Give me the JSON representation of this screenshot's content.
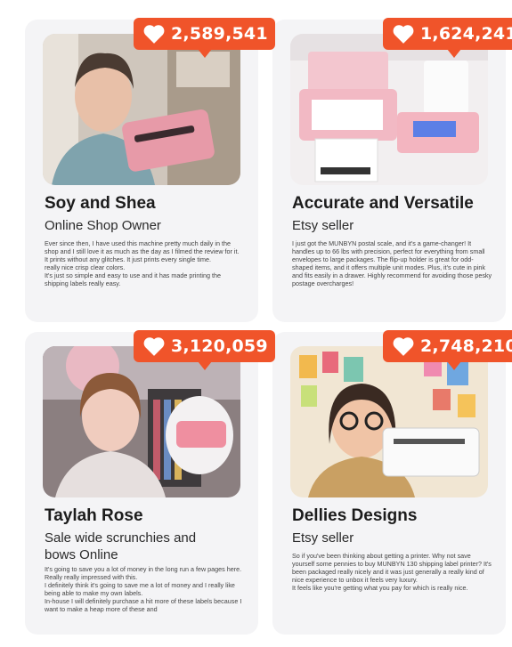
{
  "testimonials": [
    {
      "likes": "2,589,541",
      "name": "Soy and Shea",
      "role": "Online Shop Owner",
      "review": "Ever since then, I have used this machine pretty much daily in the shop and I still love it as much as the day as I filmed the review for it.\nIt prints without any glitches. It just prints every single time.\nreally nice crisp clear colors.\nIt's just so simple and easy to use and it has made printing the shipping labels really easy."
    },
    {
      "likes": "1,624,241",
      "name": "Accurate and Versatile",
      "role": "Etsy seller",
      "review": "I just got the MUNBYN postal scale, and it's a game-changer! It handles up to 66 lbs with precision, perfect for everything from small envelopes to large packages. The flip-up holder is great for odd-shaped items, and it offers multiple unit modes. Plus, it's cute in pink and fits easily in a drawer. Highly recommend for avoiding those pesky postage overcharges!"
    },
    {
      "likes": "3,120,059",
      "name": "Taylah Rose",
      "role": "Sale wide scrunchies and bows Online",
      "review": "It's going to save you a lot of money in the long run a few pages here. Really really impressed with this.\nI definitely think it's going to save me a lot of money and I really like being able to make my own labels.\nIn-house I will definitely purchase a hit more of these labels because I want to make a heap more of these and"
    },
    {
      "likes": "2,748,210",
      "name": "Dellies Designs",
      "role": "Etsy seller",
      "review": "So if you've been thinking about getting a printer. Why not save yourself some pennies to buy MUNBYN 130 shipping label printer? It's been packaged really nicely and it was just generally a really kind of nice experience to unbox it feels very luxury.\nIt feels like you're getting what you pay for which is really nice."
    }
  ],
  "colors": {
    "badge": "#f0542a",
    "card": "#f4f4f6"
  },
  "icons": {
    "badge_icon": "heart-icon"
  }
}
